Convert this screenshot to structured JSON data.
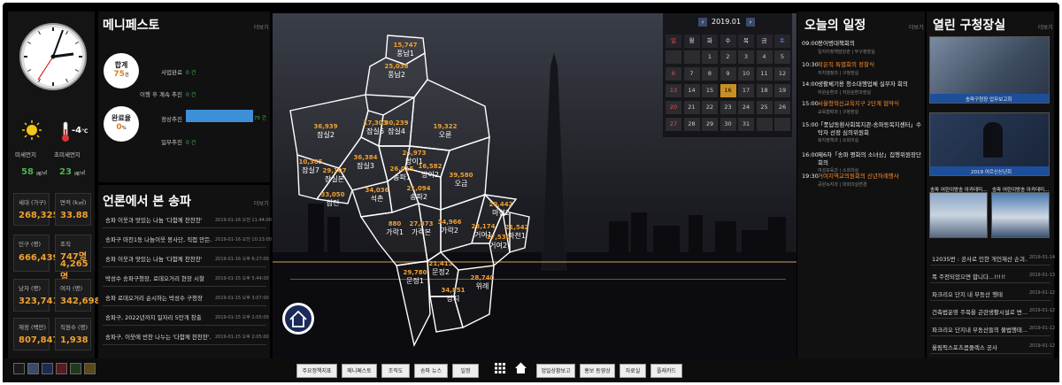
{
  "weather": {
    "fine_dust_label": "미세먼지",
    "ultra_fine_dust_label": "초미세먼지",
    "temperature": "-4",
    "temp_unit": "℃",
    "fine_dust_value": "58",
    "ultra_fine_dust_value": "23",
    "dust_unit": "㎍/㎥"
  },
  "stats": [
    {
      "label": "세대 (가구)",
      "value": "268,325"
    },
    {
      "label": "면적 (k㎡)",
      "value": "33.88"
    },
    {
      "label": "인구 (명)",
      "value": "666,439"
    },
    {
      "label": "조직",
      "value": "747명",
      "value2": "4,265명"
    },
    {
      "label": "남자 (명)",
      "value": "323,741"
    },
    {
      "label": "여자 (명)",
      "value": "342,698"
    },
    {
      "label": "재정 (백만)",
      "value": "807,847"
    },
    {
      "label": "직원수 (명)",
      "value": "1,938"
    }
  ],
  "manifesto": {
    "title": "메니페스토",
    "more": "더보기",
    "total_label": "합계",
    "total_value": "75",
    "total_unit": "건",
    "completion_label": "완료율",
    "completion_value": "0",
    "completion_unit": "%",
    "rows": [
      {
        "label": "사업완료",
        "count": "0 건"
      },
      {
        "label": "이행 후 계속 추진",
        "count": "0 건"
      },
      {
        "label": "정상추진",
        "count": "75 건"
      },
      {
        "label": "일부추진",
        "count": "0 건"
      }
    ],
    "progress_fraction": 1.0
  },
  "press": {
    "title": "언론에서 본 송파",
    "more": "더보기",
    "items": [
      {
        "text": "송파 이웃과 맛있는 나눔 '다함께 찬찬찬'",
        "date": "2019-01-16 오전 11:44:00"
      },
      {
        "text": "송파구 마천1동 나눔이웃 봉사단, 직접 만든...",
        "date": "2019-01-16 오전 10:23:00"
      },
      {
        "text": "송파 이웃과 맛있는 나눔 '다함께 찬찬찬'",
        "date": "2019-01-16 오후 6:27:00"
      },
      {
        "text": "박성수 송파구청장, 로데오거리 현장 시찰",
        "date": "2019-01-15 오후 5:44:00"
      },
      {
        "text": "송파 로데오거리 순시하는 박성수 구청장",
        "date": "2019-01-15 오후 3:07:00"
      },
      {
        "text": "송파구, 2022년까지 일자리 5만개 창출",
        "date": "2019-01-15 오후 2:05:00"
      },
      {
        "text": "송파구, 이웃에 반찬 나누는 '다함께 찬찬찬'...",
        "date": "2019-01-15 오후 2:05:00"
      }
    ]
  },
  "calendar": {
    "title": "2019.01",
    "prev": "‹",
    "next": "›",
    "weekdays": [
      "일",
      "월",
      "화",
      "수",
      "목",
      "금",
      "토"
    ],
    "days": [
      "",
      "",
      "1",
      "2",
      "3",
      "4",
      "5",
      "6",
      "7",
      "8",
      "9",
      "10",
      "11",
      "12",
      "13",
      "14",
      "15",
      "16",
      "17",
      "18",
      "19",
      "20",
      "21",
      "22",
      "23",
      "24",
      "25",
      "26",
      "27",
      "28",
      "29",
      "30",
      "31",
      "",
      ""
    ],
    "today": "16"
  },
  "schedule": {
    "title": "오늘의 일정",
    "more": "더보기",
    "items": [
      {
        "time": "09:00",
        "title": "봉어병대책회의",
        "sub": "일자리정책담당관 | 부구청장실",
        "highlight": false
      },
      {
        "time": "10:30",
        "title": "작은직 특별회의 정찰식",
        "sub": "자치행정과 | 구청장실",
        "highlight": true
      },
      {
        "time": "14:00",
        "title": "생활체기용 청소대행업체 실무자 회의",
        "sub": "자원순환과 | 자원순환과장실",
        "highlight": false
      },
      {
        "time": "15:00",
        "title": "서울형혁신교육지구 2단계 협약식",
        "sub": "교육협력과 | 구청장실",
        "highlight": true
      },
      {
        "time": "15:00",
        "title": "「풍납동환사회복지관-송파동복지센터」수탁자 선정 심의위원회",
        "sub": "복지정책과 | 소회의실",
        "highlight": false
      },
      {
        "time": "16:00",
        "title": "제6차「송파 평화의 소녀상」집행위원장단 회의",
        "sub": "여성보육과 | 소회의실",
        "highlight": false
      },
      {
        "time": "19:30",
        "title": "거여지역교의원회의 신년하례행사",
        "sub": "공원녹지과 | 대회의실변경",
        "highlight": true
      }
    ]
  },
  "open_office": {
    "title": "열린 구청장실",
    "more": "더보기",
    "photo1_caption": "송파구청장 업무보고회",
    "photo2_caption": "2019 어르신신년회",
    "small_captions": [
      "송파 어린이방송 아카데미...",
      "송파 어린이방송 아카데미..."
    ],
    "items": [
      {
        "text": "12035번 : 공사로 인한 개인재산 손괴...",
        "date": "2019-01-14"
      },
      {
        "text": "폭 주전되었으면 합니다...!!!!!",
        "date": "2019-01-13"
      },
      {
        "text": "파크리오 단지 내 부동산 행태",
        "date": "2019-01-12"
      },
      {
        "text": "건축법운영 주목을 곤란생활시설로 변...",
        "date": "2019-01-12"
      },
      {
        "text": "파크리오 단지내 부동산들의 불법행태...",
        "date": "2019-01-12"
      },
      {
        "text": "올림픽스포츠콤플렉스 공사",
        "date": "2019-01-12"
      }
    ]
  },
  "map": {
    "districts": [
      {
        "name": "풍납1",
        "value": "15,747"
      },
      {
        "name": "풍납2",
        "value": "25,038"
      },
      {
        "name": "잠실2",
        "value": "36,939"
      },
      {
        "name": "잠실6",
        "value": "17,303"
      },
      {
        "name": "잠실4",
        "value": "30,239"
      },
      {
        "name": "오륜",
        "value": "19,322"
      },
      {
        "name": "잠실3",
        "value": "36,384"
      },
      {
        "name": "방이1",
        "value": "24,973"
      },
      {
        "name": "잠실7",
        "value": "10,385"
      },
      {
        "name": "잠실본",
        "value": "29,107"
      },
      {
        "name": "송파1",
        "value": "26,015"
      },
      {
        "name": "방이2",
        "value": "16,582"
      },
      {
        "name": "삼전",
        "value": "33,050"
      },
      {
        "name": "석촌",
        "value": "34,036"
      },
      {
        "name": "송파2",
        "value": "21,094"
      },
      {
        "name": "오금",
        "value": "39,580"
      },
      {
        "name": "가락1",
        "value": "880"
      },
      {
        "name": "가락본",
        "value": "27,873"
      },
      {
        "name": "가락2",
        "value": "34,966"
      },
      {
        "name": "거여1",
        "value": "23,174"
      },
      {
        "name": "거여2",
        "value": "17,530"
      },
      {
        "name": "마천2",
        "value": "20,442"
      },
      {
        "name": "마천1",
        "value": "21,542"
      },
      {
        "name": "문정1",
        "value": "29,780"
      },
      {
        "name": "문정2",
        "value": "21,413"
      },
      {
        "name": "장지",
        "value": "34,851"
      },
      {
        "name": "위례",
        "value": "28,740"
      }
    ]
  },
  "bottom_buttons": [
    "주요정책지표",
    "메니페스토",
    "조직도",
    "송파 뉴스",
    "일정",
    "업일상황보고",
    "홍보 동영상",
    "자료실",
    "플래카드"
  ],
  "colors": {
    "accent": "#f0a030",
    "progress": "#3d8fd8",
    "highlight": "#ff8c2a",
    "today": "#c89020",
    "calendar_red": "#e05555"
  }
}
